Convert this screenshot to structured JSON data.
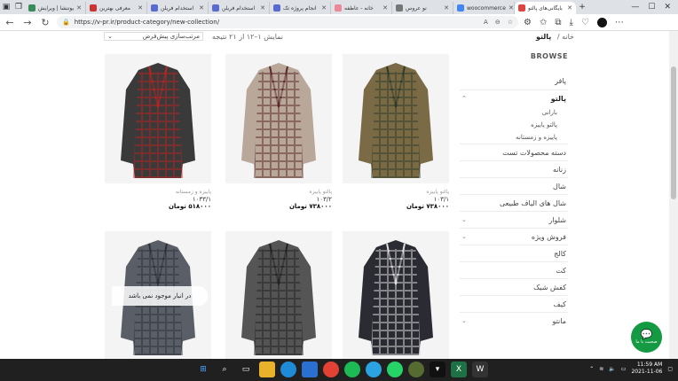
{
  "tabs": [
    {
      "label": "یوتنشا | ویرایش",
      "color": "#3a8a5a"
    },
    {
      "label": "معرفی بهترین",
      "color": "#c33"
    },
    {
      "label": "استخدام فریلن",
      "color": "#5a6bd0"
    },
    {
      "label": "استخدام فریلن",
      "color": "#5a6bd0"
    },
    {
      "label": "انجام پروژه تک",
      "color": "#5a6bd0"
    },
    {
      "label": "خانه - عاطفه",
      "color": "#e89"
    },
    {
      "label": "نو عروس",
      "color": "#777"
    },
    {
      "label": "woocommerce",
      "color": "#4285f4"
    },
    {
      "label": "بایگانی‌های پالتو",
      "color": "#d44"
    }
  ],
  "address": {
    "url": "https://v-pr.ir/product-category/new-collection/"
  },
  "page": {
    "breadcrumb_current": "پالتو",
    "breadcrumb_home": "خانه",
    "result_count": "نمایش ۱–۱۲ از ۲۱ نتیجه",
    "sort_label": "مرتب‌سازی پیش‌فرض"
  },
  "sidebar": {
    "heading": "BROWSE",
    "items": [
      {
        "label": "پافر",
        "chev": ""
      },
      {
        "label": "پالتو",
        "chev": "⌃",
        "bold": true
      },
      {
        "label": "دسته محصولات تست",
        "chev": ""
      },
      {
        "label": "زنانه",
        "chev": ""
      },
      {
        "label": "شال",
        "chev": ""
      },
      {
        "label": "شال های الیاف طبیعی",
        "chev": ""
      },
      {
        "label": "شلوار",
        "chev": "⌄"
      },
      {
        "label": "فروش ویژه",
        "chev": "⌄"
      },
      {
        "label": "کالج",
        "chev": ""
      },
      {
        "label": "کت",
        "chev": ""
      },
      {
        "label": "کفش شیک",
        "chev": ""
      },
      {
        "label": "کیف",
        "chev": ""
      },
      {
        "label": "مانتو",
        "chev": "⌄"
      }
    ],
    "subitems": [
      "بارانی",
      "پالتو پاییزه",
      "پاییزه و زمستانه"
    ]
  },
  "products": [
    {
      "cat": "پالتو پاییزه",
      "sku": "۱۰۳/۱",
      "price": "۷۳۸۰۰۰ تومان",
      "bg": "#7a6a45",
      "lines": "#2f3a2a"
    },
    {
      "cat": "پالتو پاییزه",
      "sku": "۱۰۳/۲",
      "price": "۷۳۸۰۰۰ تومان",
      "bg": "#b9a79a",
      "lines": "#5a2a2a"
    },
    {
      "cat": "پاییزه و زمستانه",
      "sku": "۱۰۳۳/۱",
      "price": "۵۱۸۰۰۰ تومان",
      "bg": "#3a3a3a",
      "lines": "#b22"
    },
    {
      "cat": "",
      "sku": "",
      "price": "",
      "bg": "#2b2b33",
      "lines": "#ddd"
    },
    {
      "cat": "",
      "sku": "",
      "price": "",
      "bg": "#555",
      "lines": "#222"
    },
    {
      "cat": "",
      "sku": "",
      "price": "",
      "bg": "#5a5e66",
      "lines": "#2d3038",
      "oos": "در انبار موجود نمی باشد"
    }
  ],
  "chat": {
    "label": "صحبت با ما"
  },
  "taskbar": {
    "time": "11:59 AM",
    "date": "2021-11-06"
  }
}
